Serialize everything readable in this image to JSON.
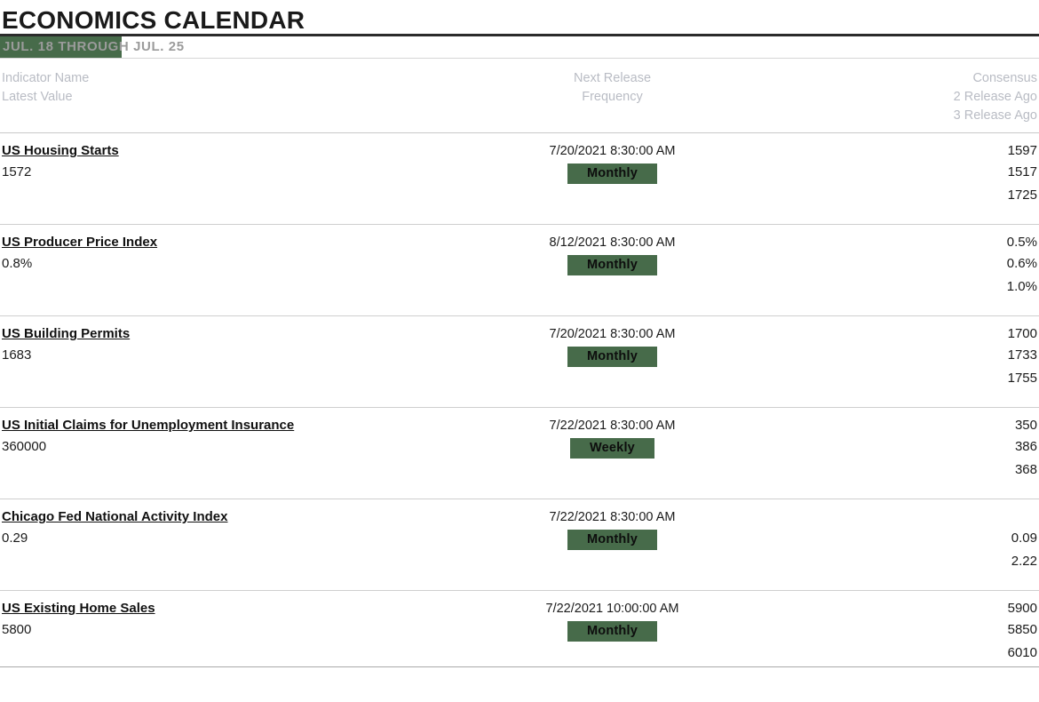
{
  "header": {
    "title": "ECONOMICS CALENDAR",
    "date_range": "JUL. 18 THROUGH JUL. 25",
    "highlight_color": "#476b4a"
  },
  "columns": {
    "left": [
      "Indicator Name",
      "Latest Value"
    ],
    "middle": [
      "Next Release",
      "Frequency"
    ],
    "right": [
      "Consensus",
      "2 Release Ago",
      "3 Release Ago"
    ]
  },
  "rows": [
    {
      "indicator": "US Housing Starts",
      "latest_value": "1572",
      "next_release": "7/20/2021 8:30:00 AM",
      "frequency": "Monthly",
      "consensus": "1597",
      "release_2_ago": "1517",
      "release_3_ago": "1725"
    },
    {
      "indicator": "US Producer Price Index",
      "latest_value": "0.8%",
      "next_release": "8/12/2021 8:30:00 AM",
      "frequency": "Monthly",
      "consensus": "0.5%",
      "release_2_ago": "0.6%",
      "release_3_ago": "1.0%"
    },
    {
      "indicator": "US Building Permits",
      "latest_value": "1683",
      "next_release": "7/20/2021 8:30:00 AM",
      "frequency": "Monthly",
      "consensus": "1700",
      "release_2_ago": "1733",
      "release_3_ago": "1755"
    },
    {
      "indicator": "US Initial Claims for Unemployment Insurance",
      "latest_value": "360000",
      "next_release": "7/22/2021 8:30:00 AM",
      "frequency": "Weekly",
      "consensus": "350",
      "release_2_ago": "386",
      "release_3_ago": "368"
    },
    {
      "indicator": "Chicago Fed National Activity Index",
      "latest_value": "0.29",
      "next_release": "7/22/2021 8:30:00 AM",
      "frequency": "Monthly",
      "consensus": "",
      "release_2_ago": "0.09",
      "release_3_ago": "2.22"
    },
    {
      "indicator": "US Existing Home Sales",
      "latest_value": "5800",
      "next_release": "7/22/2021 10:00:00 AM",
      "frequency": "Monthly",
      "consensus": "5900",
      "release_2_ago": "5850",
      "release_3_ago": "6010"
    }
  ]
}
